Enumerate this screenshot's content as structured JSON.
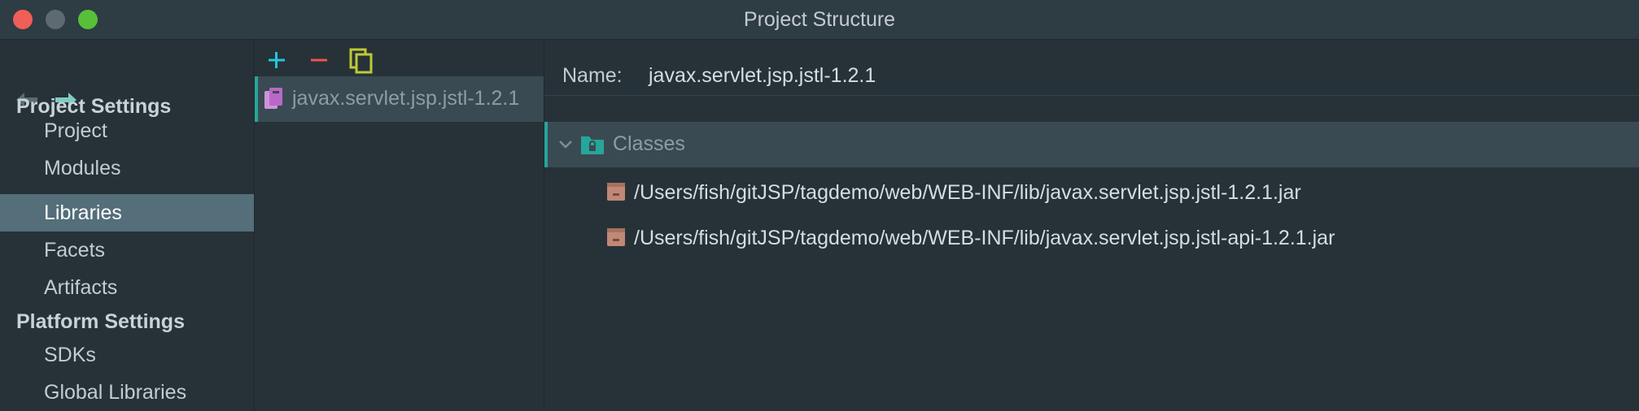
{
  "window": {
    "title": "Project Structure"
  },
  "sidebar": {
    "project_settings_header": "Project Settings",
    "platform_settings_header": "Platform Settings",
    "items": [
      {
        "label": "Project"
      },
      {
        "label": "Modules"
      },
      {
        "label": "Libraries"
      },
      {
        "label": "Facets"
      },
      {
        "label": "Artifacts"
      },
      {
        "label": "SDKs"
      },
      {
        "label": "Global Libraries"
      }
    ]
  },
  "library_list": {
    "items": [
      {
        "label": "javax.servlet.jsp.jstl-1.2.1"
      }
    ]
  },
  "detail": {
    "name_label": "Name:",
    "name_value": "javax.servlet.jsp.jstl-1.2.1",
    "classes_label": "Classes",
    "jars": [
      {
        "path": "/Users/fish/gitJSP/tagdemo/web/WEB-INF/lib/javax.servlet.jsp.jstl-1.2.1.jar"
      },
      {
        "path": "/Users/fish/gitJSP/tagdemo/web/WEB-INF/lib/javax.servlet.jsp.jstl-api-1.2.1.jar"
      }
    ]
  },
  "colors": {
    "accent": "#26a69a",
    "selection": "#546e7a",
    "add": "#26c6da",
    "remove": "#ef5350",
    "copy": "#c0ca33",
    "library_icon": "#ce93d8",
    "jar_icon": "#c08877"
  },
  "icons": {
    "back": "arrow-left-icon",
    "forward": "arrow-right-icon",
    "add": "plus-icon",
    "remove": "minus-icon",
    "copy": "copy-icon",
    "library": "library-icon",
    "chevron": "chevron-down-icon",
    "folder": "folder-icon",
    "jar": "jar-icon"
  }
}
